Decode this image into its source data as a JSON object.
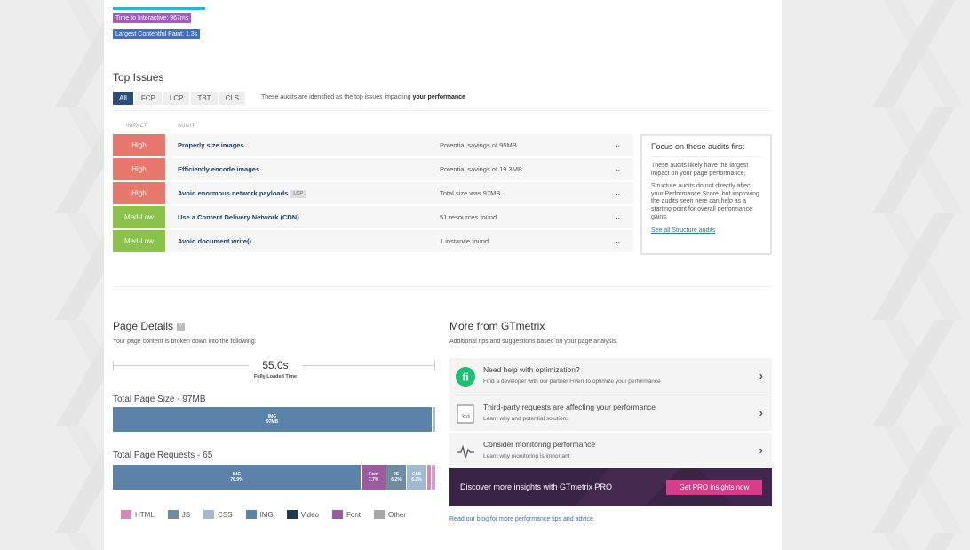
{
  "metrics": [
    {
      "label": "Time to Interactive: 967ms",
      "color": "#a45bc4"
    },
    {
      "label": "Largest Contentful Paint: 1.3s",
      "color": "#3f6ec5"
    }
  ],
  "top_issues": {
    "title": "Top Issues",
    "tabs": [
      "All",
      "FCP",
      "LCP",
      "TBT",
      "CLS"
    ],
    "note_prefix": "These audits are identified as the top issues impacting ",
    "note_bold": "your performance",
    "col_impact": "IMPACT",
    "col_audit": "AUDIT",
    "audits": [
      {
        "impact": "High",
        "impact_color": "#e8776e",
        "name": "Properly size images",
        "tag": "",
        "detail": "Potential savings of 95MB"
      },
      {
        "impact": "High",
        "impact_color": "#e8776e",
        "name": "Efficiently encode images",
        "tag": "",
        "detail": "Potential savings of 19.3MB"
      },
      {
        "impact": "High",
        "impact_color": "#e8776e",
        "name": "Avoid enormous network payloads",
        "tag": "LCP",
        "detail": "Total size was 97MB"
      },
      {
        "impact": "Med-Low",
        "impact_color": "#8bc34a",
        "name": "Use a Content Delivery Network (CDN)",
        "tag": "",
        "detail": "51 resources found"
      },
      {
        "impact": "Med-Low",
        "impact_color": "#8bc34a",
        "name": "Avoid document.write()",
        "tag": "",
        "detail": "1 instance found"
      }
    ],
    "focus": {
      "title": "Focus on these audits first",
      "p1": "These audits likely have the largest impact on your page performance.",
      "p2": "Structure audits do not directly affect your Performance Score, but improving the audits seen here can help as a starting point for overall performance gains.",
      "link": "See all Structure audits"
    }
  },
  "page_details": {
    "title": "Page Details",
    "help": "?",
    "subtitle": "Your page content is broken down into the following:",
    "fully_loaded_value": "55.0s",
    "fully_loaded_label": "Fully Loaded Time",
    "size_title": "Total Page Size - 97MB",
    "size_segments": [
      {
        "label": "IMG",
        "value_text": "97MB",
        "fraction": 0.99,
        "color": "#5b82a8"
      },
      {
        "label": "",
        "value_text": "",
        "fraction": 0.01,
        "color": "#a9bdd0"
      }
    ],
    "requests_title": "Total Page Requests - 65",
    "request_segments": [
      {
        "label": "IMG",
        "value_text": "76.9%",
        "fraction": 0.769,
        "color": "#5b82a8"
      },
      {
        "label": "Font",
        "value_text": "7.7%",
        "fraction": 0.077,
        "color": "#9c5aa1"
      },
      {
        "label": "JS",
        "value_text": "6.2%",
        "fraction": 0.062,
        "color": "#6f8aa3"
      },
      {
        "label": "CSS",
        "value_text": "6.2%",
        "fraction": 0.062,
        "color": "#a2bad0"
      },
      {
        "label": "",
        "value_text": "",
        "fraction": 0.015,
        "color": "#d487b8"
      },
      {
        "label": "",
        "value_text": "",
        "fraction": 0.015,
        "color": "#c9a0cf"
      }
    ],
    "legend": [
      {
        "label": "HTML",
        "color": "#d487b8"
      },
      {
        "label": "JS",
        "color": "#6f8aa3"
      },
      {
        "label": "CSS",
        "color": "#a2bad0"
      },
      {
        "label": "IMG",
        "color": "#5b82a8"
      },
      {
        "label": "Video",
        "color": "#1f3a57"
      },
      {
        "label": "Font",
        "color": "#9c5aa1"
      },
      {
        "label": "Other",
        "color": "#a6a6a6"
      }
    ]
  },
  "more": {
    "title": "More from GTmetrix",
    "subtitle": "Additional tips and suggestions based on your page analysis.",
    "items": [
      {
        "icon": "fiverr-icon",
        "title": "Need help with optimization?",
        "desc": "Find a developer with our partner Fiverr to optimize your performance"
      },
      {
        "icon": "third-party-icon",
        "icon_text": "3rd",
        "title": "Third-party requests are affecting your performance",
        "desc": "Learn why and potential solutions"
      },
      {
        "icon": "monitoring-pulse-icon",
        "title": "Consider monitoring performance",
        "desc": "Learn why monitoring is important"
      }
    ],
    "pro_text": "Discover more insights with GTmetrix PRO",
    "pro_button": "Get PRO insights now",
    "blog_link": "Read our blog for more performance tips and advice."
  }
}
